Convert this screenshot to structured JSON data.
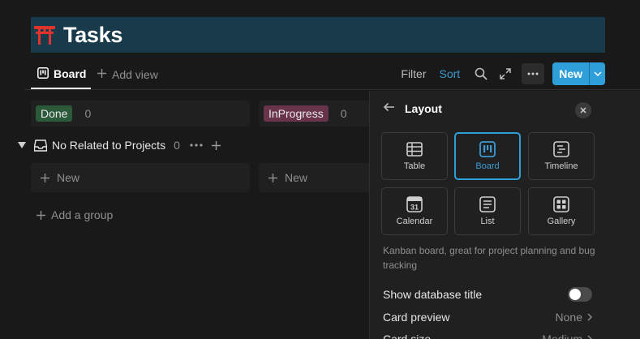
{
  "header": {
    "title": "Tasks",
    "icon": "torii-gate-icon"
  },
  "views": {
    "active_tab": "Board",
    "add_view": "Add view"
  },
  "toolbar": {
    "filter": "Filter",
    "sort": "Sort",
    "new": "New"
  },
  "board": {
    "columns": [
      {
        "label": "Done",
        "count": "0",
        "color": "#2b5a3b"
      },
      {
        "label": "InProgress",
        "count": "0",
        "color": "#693349"
      }
    ],
    "group": {
      "label": "No Related to Projects",
      "count": "0"
    },
    "new_card": "New",
    "add_group": "Add a group"
  },
  "panel": {
    "title": "Layout",
    "layouts": [
      {
        "label": "Table",
        "icon": "table-icon"
      },
      {
        "label": "Board",
        "icon": "board-icon",
        "selected": true
      },
      {
        "label": "Timeline",
        "icon": "timeline-icon"
      },
      {
        "label": "Calendar",
        "icon": "calendar-icon",
        "day": "31"
      },
      {
        "label": "List",
        "icon": "list-icon"
      },
      {
        "label": "Gallery",
        "icon": "gallery-icon"
      }
    ],
    "description": "Kanban board, great for project planning and bug tracking",
    "options": {
      "show_title": {
        "label": "Show database title",
        "enabled": false
      },
      "card_preview": {
        "label": "Card preview",
        "value": "None"
      },
      "card_size": {
        "label": "Card size",
        "value": "Medium"
      }
    }
  },
  "colors": {
    "accent": "#2e9fd8",
    "banner": "#193a4a",
    "background": "#191919"
  }
}
